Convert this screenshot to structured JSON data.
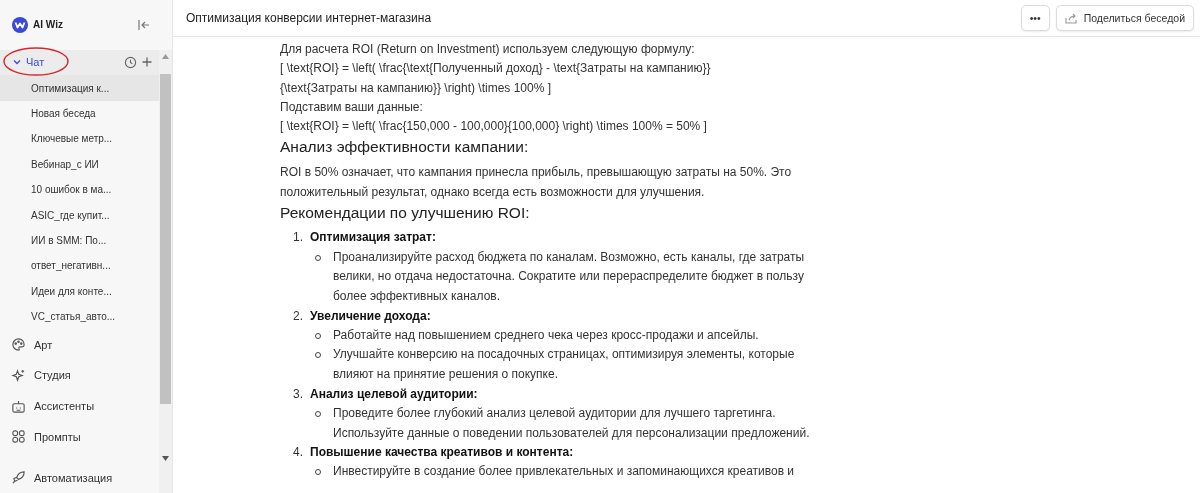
{
  "sidebar": {
    "brand": "AI Wiz",
    "chat_section": {
      "label": "Чат",
      "expanded": true,
      "circled": true,
      "items": [
        {
          "label": "Оптимизация к...",
          "selected": true
        },
        {
          "label": "Новая беседа",
          "selected": false
        },
        {
          "label": "Ключевые метр...",
          "selected": false
        },
        {
          "label": "Вебинар_с ИИ",
          "selected": false
        },
        {
          "label": "10 ошибок в ма...",
          "selected": false
        },
        {
          "label": "ASIC_где купит...",
          "selected": false
        },
        {
          "label": "ИИ в SMM: По...",
          "selected": false
        },
        {
          "label": "ответ_негативн...",
          "selected": false
        },
        {
          "label": "Идеи для конте...",
          "selected": false
        },
        {
          "label": "VC_статья_авто...",
          "selected": false
        }
      ]
    },
    "nav": [
      {
        "kind": "palette",
        "label": "Арт"
      },
      {
        "kind": "sparkles",
        "label": "Студия"
      },
      {
        "kind": "bot",
        "label": "Ассистенты"
      },
      {
        "kind": "grid",
        "label": "Промпты"
      },
      {
        "kind": "rocket",
        "label": "Автоматизация"
      }
    ]
  },
  "header": {
    "title": "Оптимизация конверсии интернет-магазина",
    "more": "•••",
    "share": "Поделиться беседой"
  },
  "message": [
    {
      "kind": "p",
      "text": "Для расчета ROI (Return on Investment) используем следующую формулу:"
    },
    {
      "kind": "p",
      "text": "[ \\text{ROI} = \\left( \\frac{\\text{Полученный доход} - \\text{Затраты на кампанию}}"
    },
    {
      "kind": "p",
      "text": "{\\text{Затраты на кампанию}} \\right) \\times 100% ]"
    },
    {
      "kind": "p",
      "text": "Подставим ваши данные:"
    },
    {
      "kind": "p",
      "text": "[ \\text{ROI} = \\left( \\frac{150,000 - 100,000}{100,000} \\right) \\times 100% = 50% ]"
    },
    {
      "kind": "h",
      "text": "Анализ эффективности кампании:"
    },
    {
      "kind": "para",
      "text": "ROI в 50% означает, что кампания принесла прибыль, превышающую затраты на 50%. Это положительный результат, однако всегда есть возможности для улучшения."
    },
    {
      "kind": "h",
      "text": "Рекомендации по улучшению ROI:"
    },
    {
      "kind": "list",
      "items": [
        {
          "number": "1.",
          "title": "Оптимизация затрат:",
          "bullets": [
            "Проанализируйте расход бюджета по каналам. Возможно, есть каналы, где затраты велики, но отдача недостаточна. Сократите или перераспределите бюджет в пользу более эффективных каналов."
          ]
        },
        {
          "number": "2.",
          "title": "Увеличение дохода:",
          "bullets": [
            "Работайте над повышением среднего чека через кросс-продажи и апсейлы.",
            "Улучшайте конверсию на посадочных страницах, оптимизируя элементы, которые влияют на принятие решения о покупке."
          ]
        },
        {
          "number": "3.",
          "title": "Анализ целевой аудитории:",
          "bullets": [
            "Проведите более глубокий анализ целевой аудитории для лучшего таргетинга. Используйте данные о поведении пользователей для персонализации предложений."
          ]
        },
        {
          "number": "4.",
          "title": "Повышение качества креативов и контента:",
          "bullets": [
            "Инвестируйте в создание более привлекательных и запоминающихся креативов и"
          ]
        }
      ]
    }
  ]
}
